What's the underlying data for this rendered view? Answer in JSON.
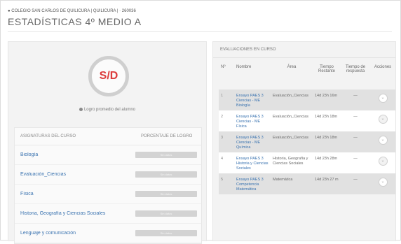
{
  "breadcrumb": "● COLEGIO SAN CARLOS DE QUILICURA | QUILICURA | · 260036",
  "page_title": "ESTADÍSTICAS 4º MEDIO A",
  "summary": {
    "gauge_value": "S/D",
    "caption": "Logro promedio del alumno"
  },
  "subjects": {
    "headers": {
      "subject": "ASIGNATURAS DEL CURSO",
      "percent": "PORCENTAJE DE LOGRO"
    },
    "rows": [
      {
        "name": "Biología",
        "bar_label": "Sin datos"
      },
      {
        "name": "Evaluación_Ciencias",
        "bar_label": "Sin datos"
      },
      {
        "name": "Física",
        "bar_label": "Sin datos"
      },
      {
        "name": "Historia, Geografía y Ciencias Sociales",
        "bar_label": "Sin datos"
      },
      {
        "name": "Lenguaje y comunicación",
        "bar_label": "Sin datos"
      }
    ]
  },
  "evaluations": {
    "title": "EVALUACIONES EN CURSO",
    "headers": {
      "num": "Nº",
      "name": "Nombre",
      "area": "Área",
      "time_left": "Tiempo Restante",
      "time_answer": "Tiempo de respuesta",
      "actions": "Acciones"
    },
    "rows": [
      {
        "num": "1",
        "name": "Ensayo PAES 3 Ciencias - ME Biología",
        "area": "Evaluación_Ciencias",
        "time_left": "14d 23h 16m",
        "time_answer": "—",
        "action": "⌄"
      },
      {
        "num": "2",
        "name": "Ensayo PAES 3 Ciencias - ME Física",
        "area": "Evaluación_Ciencias",
        "time_left": "14d 23h 18m",
        "time_answer": "—",
        "action": "⌄"
      },
      {
        "num": "3",
        "name": "Ensayo PAES 3 Ciencias - ME Química",
        "area": "Evaluación_Ciencias",
        "time_left": "14d 23h 18m",
        "time_answer": "—",
        "action": "⌄"
      },
      {
        "num": "4",
        "name": "Ensayo PAES 3 Historia y Ciencias Sociales",
        "area": "Historia, Geografía y Ciencias Sociales",
        "time_left": "14d 23h 28m",
        "time_answer": "—",
        "action": "⌄"
      },
      {
        "num": "5",
        "name": "Ensayo PAES 3 Competencia Matemática",
        "area": "Matemática",
        "time_left": "14d 23h 27 m",
        "time_answer": "—",
        "action": "⌄"
      }
    ]
  }
}
